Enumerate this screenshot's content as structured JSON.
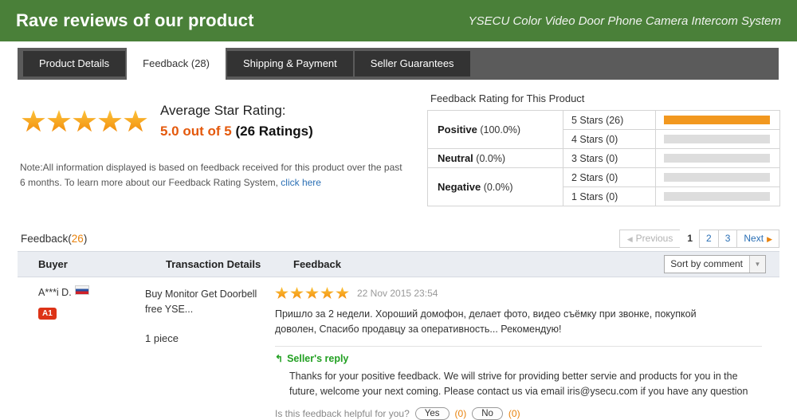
{
  "banner": {
    "title": "Rave reviews of our product",
    "product": "YSECU Color Video Door Phone Camera Intercom System"
  },
  "tabs": [
    {
      "label": "Product Details",
      "active": false
    },
    {
      "label": "Feedback (28)",
      "active": true
    },
    {
      "label": "Shipping & Payment",
      "active": false
    },
    {
      "label": "Seller Guarantees",
      "active": false
    }
  ],
  "average": {
    "heading": "Average Star Rating:",
    "score": "5.0 out of 5",
    "count": "(26 Ratings)",
    "stars": 5
  },
  "note": {
    "text": "Note:All information displayed is based on feedback received for this product over the past 6 months. To learn more about our Feedback Rating System, ",
    "link": "click here"
  },
  "feedback_rating": {
    "title": "Feedback Rating for This Product",
    "groups": [
      {
        "name": "Positive",
        "pct": "(100.0%)"
      },
      {
        "name": "Neutral",
        "pct": "(0.0%)"
      },
      {
        "name": "Negative",
        "pct": "(0.0%)"
      }
    ],
    "rows": [
      {
        "label": "5 Stars (26)",
        "value": 26,
        "bar_pct": 100
      },
      {
        "label": "4 Stars (0)",
        "value": 0,
        "bar_pct": 0
      },
      {
        "label": "3 Stars (0)",
        "value": 0,
        "bar_pct": 0
      },
      {
        "label": "2 Stars (0)",
        "value": 0,
        "bar_pct": 0
      },
      {
        "label": "1 Stars (0)",
        "value": 0,
        "bar_pct": 0
      }
    ],
    "bar_color": "#f2981f",
    "track_color": "#dddddd"
  },
  "list": {
    "count_label": "Feedback(",
    "count_value": "26",
    "count_close": ")",
    "pagination": {
      "previous": "Previous",
      "pages": [
        "1",
        "2",
        "3"
      ],
      "current": "1",
      "next": "Next"
    },
    "columns": {
      "buyer": "Buyer",
      "transaction": "Transaction Details",
      "feedback": "Feedback"
    },
    "sort": {
      "value": "Sort by comment"
    }
  },
  "review": {
    "buyer_name": "A***i D.",
    "buyer_flag": "russia-flag",
    "buyer_badge": "A1",
    "transaction_title": "Buy Monitor Get Doorbell free YSE...",
    "quantity": "1 piece",
    "stars": 5,
    "date": "22 Nov 2015 23:54",
    "text": "Пришло за 2 недели. Хороший домофон, делает фото, видео съёмку при звонке, покупкой доволен, Спасибо продавцу за оперативность... Рекомендую!",
    "reply_heading": "Seller's reply",
    "reply_text": "Thanks for your positive feedback. We will strive for providing better servie and products for you in the future, welcome your next coming. Please contact us via email iris@ysecu.com if you have any question",
    "helpful_question": "Is this feedback helpful for you?",
    "yes_label": "Yes",
    "yes_count": "(0)",
    "no_label": "No",
    "no_count": "(0)"
  }
}
